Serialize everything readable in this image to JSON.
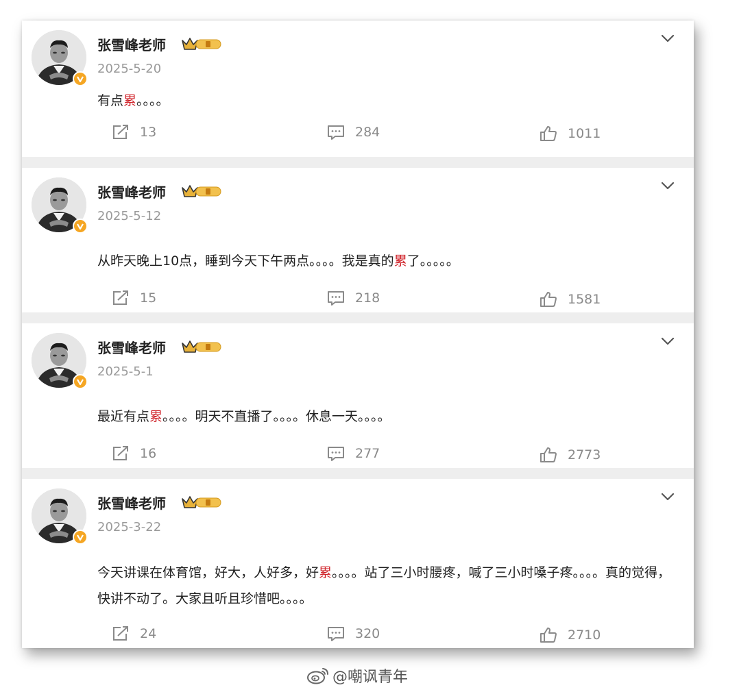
{
  "posts": [
    {
      "username": "张雪峰老师",
      "date": "2025-5-20",
      "text_segments": [
        {
          "t": "有点",
          "hl": false
        },
        {
          "t": "累",
          "hl": true
        },
        {
          "t": "。。。。",
          "hl": false
        }
      ],
      "share_count": "13",
      "comment_count": "284",
      "like_count": "1011"
    },
    {
      "username": "张雪峰老师",
      "date": "2025-5-12",
      "text_segments": [
        {
          "t": "从昨天晚上10点，睡到今天下午两点。。。。我是真的",
          "hl": false
        },
        {
          "t": "累",
          "hl": true
        },
        {
          "t": "了。。。。。",
          "hl": false
        }
      ],
      "share_count": "15",
      "comment_count": "218",
      "like_count": "1581"
    },
    {
      "username": "张雪峰老师",
      "date": "2025-5-1",
      "text_segments": [
        {
          "t": "最近有点",
          "hl": false
        },
        {
          "t": "累",
          "hl": true
        },
        {
          "t": "。。。。明天不直播了。。。。休息一天。。。。",
          "hl": false
        }
      ],
      "share_count": "16",
      "comment_count": "277",
      "like_count": "2773"
    },
    {
      "username": "张雪峰老师",
      "date": "2025-3-22",
      "text_segments": [
        {
          "t": "今天讲课在体育馆，好大，人好多，好",
          "hl": false
        },
        {
          "t": "累",
          "hl": true
        },
        {
          "t": "。。。。站了三小时腰疼，喊了三小时嗓子疼。。。。真的觉得，快讲不动了。大家且听且珍惜吧。。。。",
          "hl": false
        }
      ],
      "share_count": "24",
      "comment_count": "320",
      "like_count": "2710"
    }
  ],
  "watermark": "@嘲讽青年",
  "colors": {
    "highlight": "#d0242b",
    "verified_badge": "#f5a623",
    "muted_text": "#9a9a9a",
    "separator": "#eeeeee"
  },
  "icons": {
    "share": "share-icon",
    "comment": "comment-icon",
    "like": "like-icon",
    "more": "chevron-down-icon",
    "member": "crown-icon",
    "verified": "verified-v-icon"
  }
}
